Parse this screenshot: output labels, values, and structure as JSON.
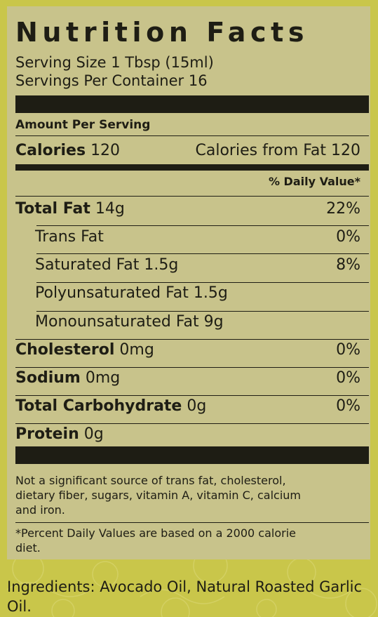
{
  "panel": {
    "title": "Nutrition Facts",
    "serving_size": "Serving Size 1 Tbsp (15ml)",
    "servings_per_container": "Servings Per Container 16",
    "amount_per_serving": "Amount Per Serving",
    "calories_label": "Calories",
    "calories_value": "120",
    "calories_from_fat": "Calories from Fat 120",
    "daily_value_header": "% Daily Value*",
    "rows": [
      {
        "label": "Total Fat",
        "amount": "14g",
        "dv": "22%"
      },
      {
        "label": "Trans Fat",
        "amount": "",
        "dv": "0%"
      },
      {
        "label": "Saturated Fat",
        "amount": "1.5g",
        "dv": "8%"
      },
      {
        "label": "Polyunsaturated Fat",
        "amount": "1.5g",
        "dv": ""
      },
      {
        "label": "Monounsaturated Fat",
        "amount": "9g",
        "dv": ""
      },
      {
        "label": "Cholesterol",
        "amount": "0mg",
        "dv": "0%"
      },
      {
        "label": "Sodium",
        "amount": "0mg",
        "dv": "0%"
      },
      {
        "label": "Total Carbohydrate",
        "amount": "0g",
        "dv": "0%"
      },
      {
        "label": "Protein",
        "amount": "0g",
        "dv": ""
      }
    ],
    "note_line1": "Not a significant source of trans fat, cholesterol,",
    "note_line2": "dietary fiber, sugars, vitamin A, vitamin C, calcium",
    "note_line3": "and iron.",
    "footnote_line1": "*Percent Daily Values are based on a 2000 calorie",
    "footnote_line2": "diet."
  },
  "ingredients": {
    "line1": "Ingredients: Avocado Oil, Natural Roasted Garlic",
    "line2": "Oil."
  },
  "colors": {
    "background": "#c9c64a",
    "panel": "#c8c38b",
    "ink": "#1e1d14"
  }
}
